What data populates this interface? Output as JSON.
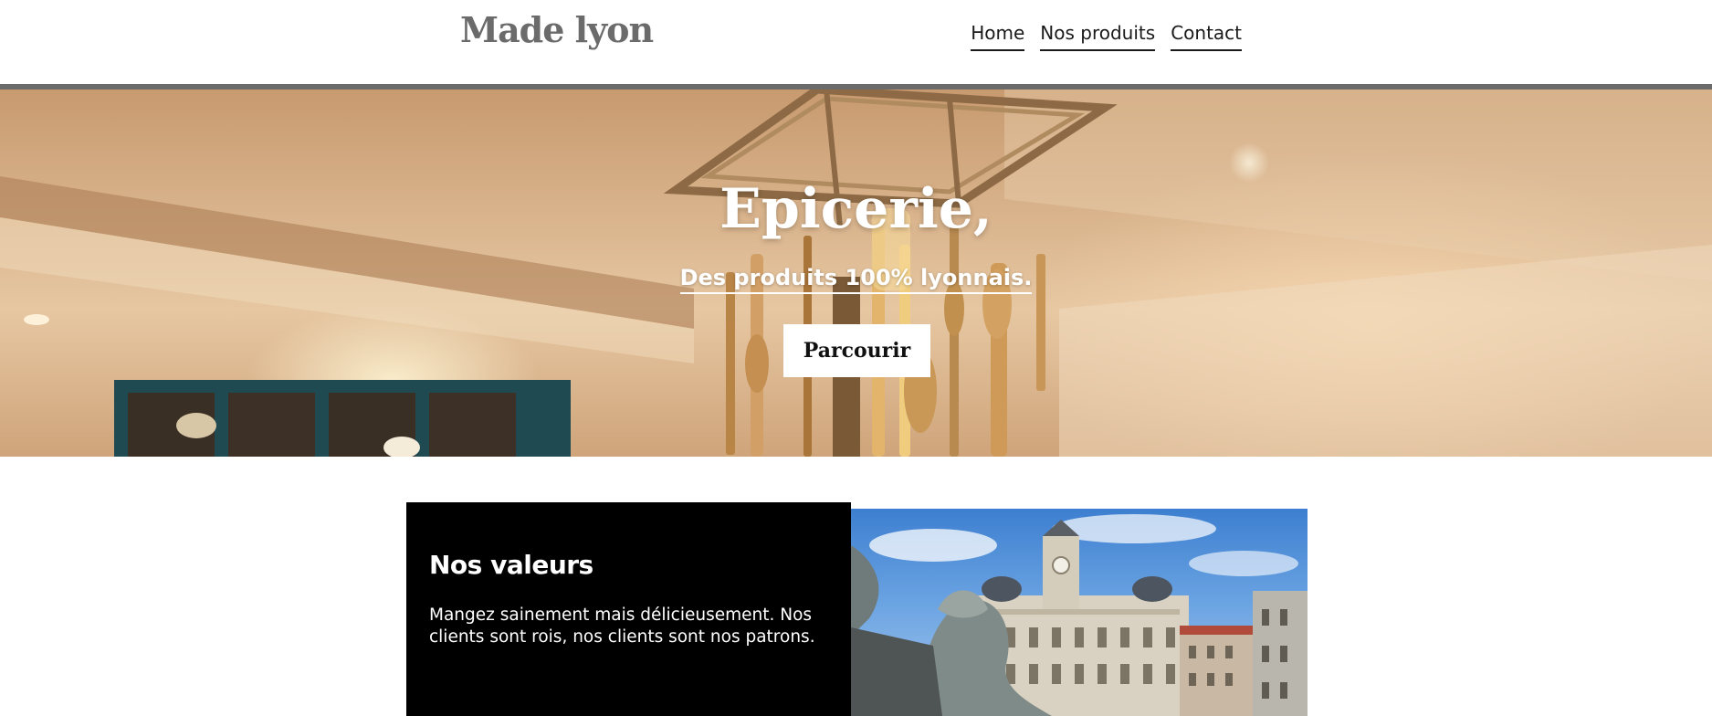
{
  "header": {
    "logo": "Made lyon",
    "nav": [
      {
        "label": "Home"
      },
      {
        "label": "Nos produits"
      },
      {
        "label": "Contact"
      }
    ]
  },
  "hero": {
    "title": "Epicerie,",
    "subtitle": "Des produits 100% lyonnais.",
    "button_label": "Parcourir"
  },
  "values": {
    "title": "Nos valeurs",
    "text": "Mangez sainement mais délicieusement. Nos clients sont rois, nos clients sont nos patrons."
  },
  "colors": {
    "logo": "#6b6b6b",
    "header_rule": "#6b6b6b",
    "card_background": "#000000",
    "button_background": "#ffffff"
  }
}
